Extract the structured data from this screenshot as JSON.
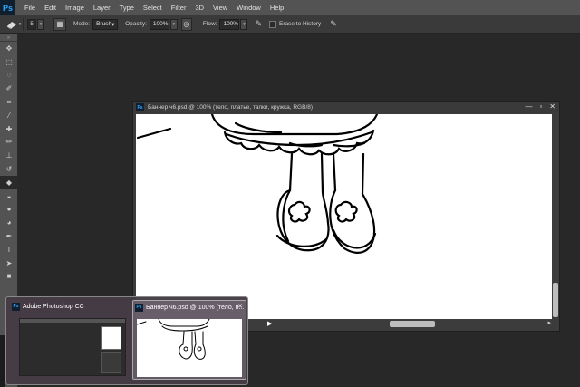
{
  "app": {
    "logo": "Ps"
  },
  "menu": [
    "File",
    "Edit",
    "Image",
    "Layer",
    "Type",
    "Select",
    "Filter",
    "3D",
    "View",
    "Window",
    "Help"
  ],
  "options": {
    "brush_size": "5",
    "mode_label": "Mode:",
    "mode_value": "Brush",
    "opacity_label": "Opacity:",
    "opacity_value": "100%",
    "flow_label": "Flow:",
    "flow_value": "100%",
    "erase_history_label": "Erase to History"
  },
  "tools": [
    "move-icon",
    "marquee-icon",
    "lasso-icon",
    "quick-select-icon",
    "crop-icon",
    "eyedropper-icon",
    "healing-icon",
    "brush-icon",
    "stamp-icon",
    "history-brush-icon",
    "eraser-icon",
    "bucket-icon",
    "blur-icon",
    "dodge-icon",
    "pen-icon",
    "type-icon",
    "path-select-icon",
    "shape-icon"
  ],
  "active_tool": "eraser-icon",
  "document": {
    "title": "Баннер ч6.psd @ 100% (тело, платье, тапки, кружка, RGB/8)",
    "ps_icon": "Ps"
  },
  "taskbar": {
    "thumb_left_title": "Adobe Photoshop CC",
    "thumb_right_title": "Баннер ч6.psd @ 100% (тело, п...",
    "close_glyph": "✕"
  }
}
